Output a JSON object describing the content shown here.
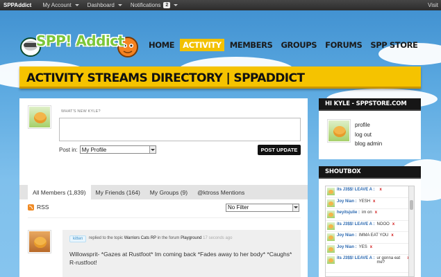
{
  "adminbar": {
    "brand": "SPPAddict",
    "my_account": "My Account",
    "dashboard": "Dashboard",
    "notifications": "Notifications",
    "notification_count": "2",
    "visit": "Visit"
  },
  "logo": {
    "text": "SPP! Addict"
  },
  "nav": [
    "HOME",
    "ACTIVITY",
    "MEMBERS",
    "GROUPS",
    "FORUMS",
    "SPP STORE"
  ],
  "nav_active": "ACTIVITY",
  "page_title": "ACTIVITY STREAMS DIRECTORY | SPPADDICT",
  "post_form": {
    "prompt": "WHAT'S NEW KYLE?",
    "textarea_value": "",
    "post_in_label": "Post in:",
    "post_in_value": "My Profile",
    "submit_label": "POST UPDATE"
  },
  "tabs": [
    {
      "label": "All Members (1,839)",
      "active": true
    },
    {
      "label": "My Friends (164)",
      "active": false
    },
    {
      "label": "My Groups (9)",
      "active": false
    },
    {
      "label": "@ktross Mentions",
      "active": false
    }
  ],
  "rss_label": "RSS",
  "filter_value": "No Filter",
  "activity": {
    "user": "kitten",
    "action": "replied to the topic",
    "topic": "Warriors Cats RP",
    "in_forum": "in the forum",
    "forum": "Playground",
    "time": "17 seconds ago",
    "text": "Willowsprit- *Gazes at Rustfoot* Im coming back *Fades away to her body* *Caughs* R-rustfoot!"
  },
  "user_widget": {
    "title": "HI KYLE - SPPSTORE.COM",
    "links": [
      "profile",
      "log out",
      "blog admin"
    ]
  },
  "shoutbox": {
    "title": "SHOUTBOX",
    "entries": [
      {
        "name": "its J3$$! LEAVE A :",
        "msg": "",
        "x": "x"
      },
      {
        "name": "Joy Nian :",
        "msg": "YESH",
        "x": "x"
      },
      {
        "name": "heyitsjulie :",
        "msg": "im on",
        "x": "x"
      },
      {
        "name": "its J3$$! LEAVE A :",
        "msg": "NOOO",
        "x": "x"
      },
      {
        "name": "Joy Nian :",
        "msg": "IMMA EAT YOU",
        "x": "x"
      },
      {
        "name": "Joy Nian :",
        "msg": "YES",
        "x": "x"
      },
      {
        "name": "its J3$$! LEAVE A :",
        "msg": "ur gonna eat me?",
        "x": "x"
      }
    ]
  },
  "colors": {
    "accent": "#f5c300",
    "dark": "#161616",
    "sky": "#5aa8e0"
  }
}
